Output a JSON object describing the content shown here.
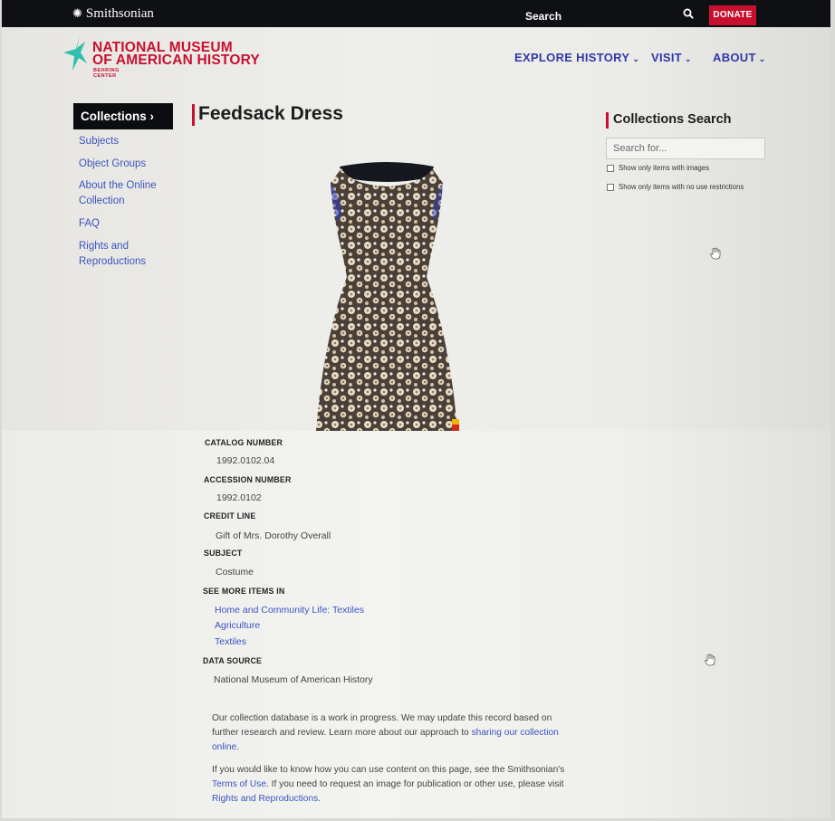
{
  "topbar": {
    "brand": "Smithsonian",
    "search_label": "Search",
    "donate_label": "DONATE"
  },
  "logo": {
    "line1": "NATIONAL MUSEUM",
    "line2": "OF AMERICAN HISTORY",
    "subline": "BEHRING CENTER"
  },
  "nav": {
    "items": [
      {
        "label": "EXPLORE HISTORY"
      },
      {
        "label": "VISIT"
      },
      {
        "label": "ABOUT"
      }
    ]
  },
  "sidebar": {
    "active": "Collections",
    "items": [
      {
        "label": "Subjects"
      },
      {
        "label": "Object Groups"
      },
      {
        "label": "About the Online Collection"
      },
      {
        "label": "FAQ"
      },
      {
        "label": "Rights and Reproductions"
      }
    ]
  },
  "page": {
    "title": "Feedsack Dress"
  },
  "collections_search": {
    "title": "Collections Search",
    "placeholder": "Search for...",
    "option_images": "Show only items with images",
    "option_no_restrictions": "Show only items with no use restrictions"
  },
  "record": {
    "catalog_label": "CATALOG NUMBER",
    "catalog_value": "1992.0102.04",
    "accession_label": "ACCESSION NUMBER",
    "accession_value": "1992.0102",
    "credit_label": "CREDIT LINE",
    "credit_value": "Gift of Mrs. Dorothy Overall",
    "subject_label": "SUBJECT",
    "subject_value": "Costume",
    "see_more_label": "SEE MORE ITEMS IN",
    "see_more_links": [
      {
        "label": "Home and Community Life: Textiles"
      },
      {
        "label": "Agriculture"
      },
      {
        "label": "Textiles"
      }
    ],
    "source_label": "DATA SOURCE",
    "source_value": "National Museum of American History"
  },
  "notes": {
    "p1_text": "Our collection database is a work in progress. We may update this record based on further research and review. Learn more about our approach to ",
    "p1_link": "sharing our collection online",
    "p1_end": ".",
    "p2_text1": "If you would like to know how you can use content on this page, see the Smithsonian's ",
    "p2_link1": "Terms of Use",
    "p2_text2": ". If you need to request an image for publication or other use, please visit ",
    "p2_link2": "Rights and Reproductions",
    "p2_end": "."
  },
  "colors": {
    "accent_red": "#c8102e",
    "nav_blue": "#2f3aa8",
    "link_blue": "#3a55c0",
    "topbar_black": "#0f1014"
  }
}
